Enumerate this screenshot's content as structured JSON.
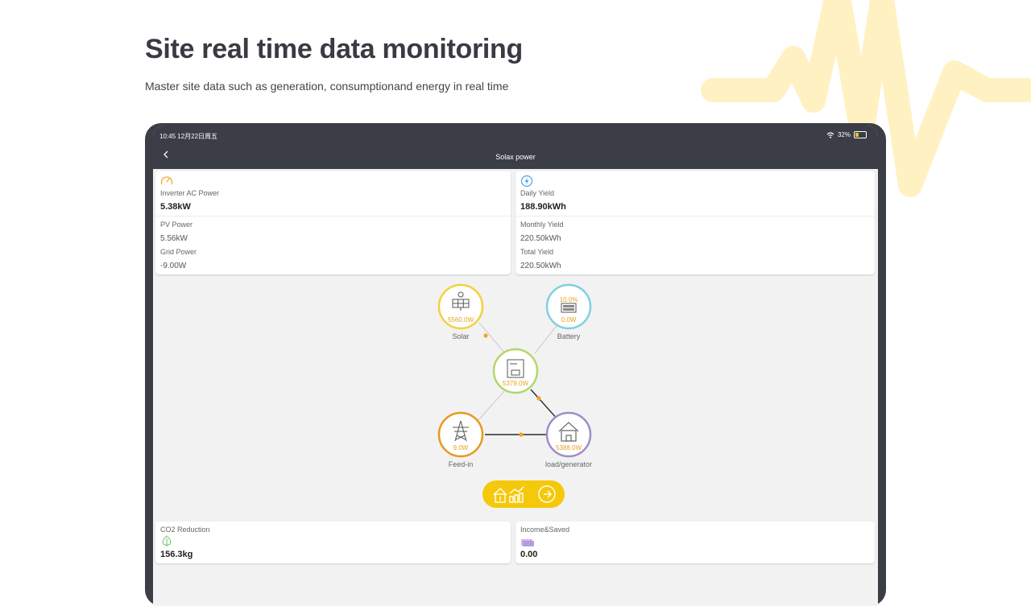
{
  "page": {
    "title": "Site real time data monitoring",
    "subtitle": "Master site data such as generation, consumptionand energy in real time"
  },
  "device": {
    "status_time": "10:45   12月22日周五",
    "battery_percent": "32%",
    "nav_title": "Solax power"
  },
  "inverter_card": {
    "main_label": "Inverter AC Power",
    "main_value": "5.38kW",
    "pv_label": "PV Power",
    "pv_value": "5.56kW",
    "grid_label": "Grid Power",
    "grid_value": "-9.00W"
  },
  "yield_card": {
    "main_label": "Daily Yield",
    "main_value": "188.90kWh",
    "monthly_label": "Monthly Yield",
    "monthly_value": "220.50kWh",
    "total_label": "Total Yield",
    "total_value": "220.50kWh"
  },
  "flow": {
    "solar": {
      "label": "Solar",
      "value": "5560.0W",
      "color": "#f2d23c"
    },
    "battery": {
      "label": "Battery",
      "percent": "10.0%",
      "value": "0.0W",
      "color": "#7fd0e0"
    },
    "inverter": {
      "value": "5379.0W",
      "color": "#b4d66a"
    },
    "feedin": {
      "label": "Feed-in",
      "value": "9.0W",
      "color": "#e89a1c"
    },
    "load": {
      "label": "load/generator",
      "value": "5388.0W",
      "color": "#9b8fc8"
    }
  },
  "co2_card": {
    "label": "CO2 Reduction",
    "value": "156.3kg"
  },
  "income_card": {
    "label": "Income&Saved",
    "value": "0.00"
  },
  "colors": {
    "accent": "#f5c80a",
    "frame": "#3b3d47",
    "deco": "#fff1c2"
  }
}
